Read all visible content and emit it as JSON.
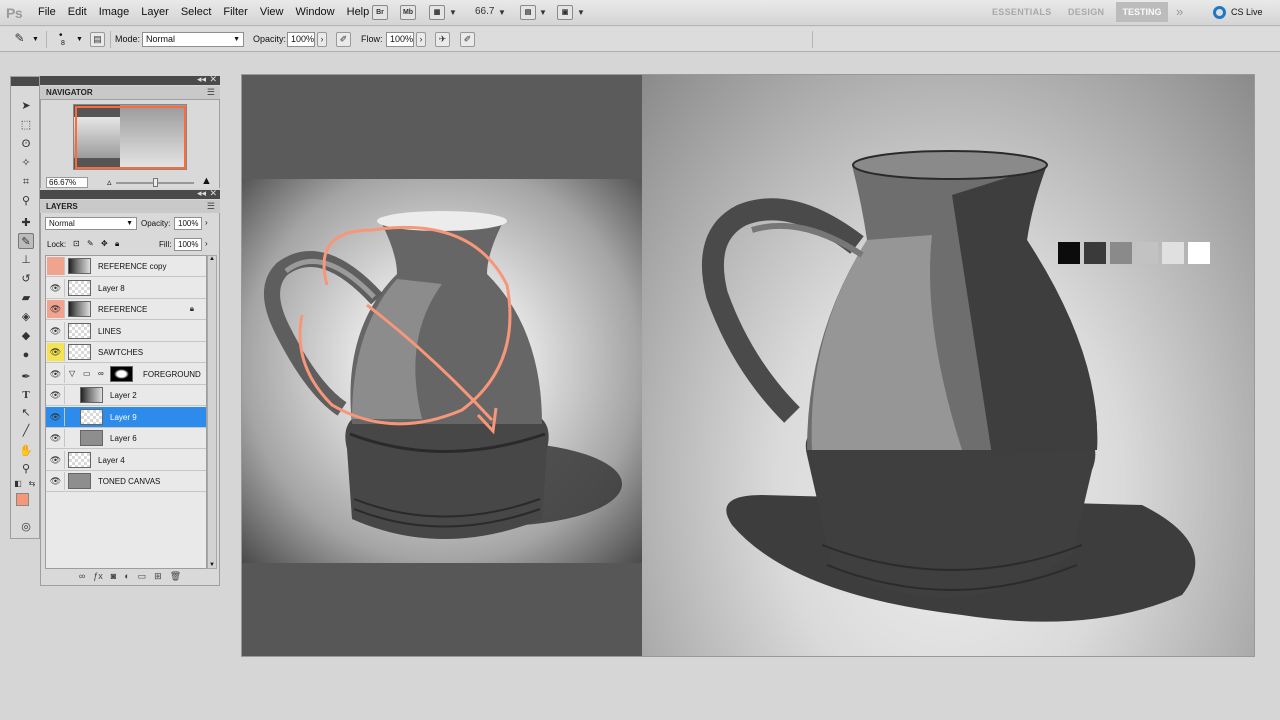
{
  "app": {
    "logo": "Ps",
    "menu": [
      "File",
      "Edit",
      "Image",
      "Layer",
      "Select",
      "Filter",
      "View",
      "Window",
      "Help"
    ],
    "bridge_label": "Br",
    "minibridge_label": "Mb",
    "zoom_value": "66.7",
    "workspaces": [
      "ESSENTIALS",
      "DESIGN",
      "TESTING"
    ],
    "active_workspace": "TESTING",
    "more_glyph": "»",
    "cs_live": "CS Live"
  },
  "options": {
    "brush_size": "8",
    "mode_label": "Mode:",
    "mode_value": "Normal",
    "opacity_label": "Opacity:",
    "opacity_value": "100%",
    "flow_label": "Flow:",
    "flow_value": "100%"
  },
  "navigator": {
    "title": "NAVIGATOR",
    "zoom": "66.67%",
    "slider_level_percent": 50
  },
  "layers_panel": {
    "title": "LAYERS",
    "blend_mode": "Normal",
    "opacity_label": "Opacity:",
    "opacity_value": "100%",
    "lock_label": "Lock:",
    "fill_label": "Fill:",
    "fill_value": "100%",
    "layers": [
      {
        "name": "REFERENCE copy",
        "visible": false,
        "highlight": "red",
        "thumb": "photo",
        "indent": 0,
        "locked": false,
        "selected": false
      },
      {
        "name": "Layer 8",
        "visible": true,
        "highlight": "none",
        "thumb": "transparent",
        "indent": 0,
        "locked": false,
        "selected": false
      },
      {
        "name": "REFERENCE",
        "visible": true,
        "highlight": "red",
        "thumb": "photo",
        "indent": 0,
        "locked": true,
        "selected": false
      },
      {
        "name": "LINES",
        "visible": true,
        "highlight": "none",
        "thumb": "transparent",
        "indent": 0,
        "locked": false,
        "selected": false
      },
      {
        "name": "SAWTCHES",
        "visible": true,
        "highlight": "yellow",
        "thumb": "transparent",
        "indent": 0,
        "locked": false,
        "selected": false
      },
      {
        "name": "FOREGROUND",
        "visible": true,
        "highlight": "none",
        "thumb": "mask",
        "indent": 0,
        "locked": false,
        "selected": false,
        "group": true
      },
      {
        "name": "Layer 2",
        "visible": true,
        "highlight": "none",
        "thumb": "photo",
        "indent": 1,
        "locked": false,
        "selected": false
      },
      {
        "name": "Layer 9",
        "visible": true,
        "highlight": "none",
        "thumb": "transparent",
        "indent": 1,
        "locked": false,
        "selected": true
      },
      {
        "name": "Layer 6",
        "visible": true,
        "highlight": "none",
        "thumb": "grey",
        "indent": 1,
        "locked": false,
        "selected": false
      },
      {
        "name": "Layer 4",
        "visible": true,
        "highlight": "none",
        "thumb": "transparent",
        "indent": 0,
        "locked": false,
        "selected": false
      },
      {
        "name": "TONED CANVAS",
        "visible": true,
        "highlight": "none",
        "thumb": "grey",
        "indent": 0,
        "locked": false,
        "selected": false
      }
    ]
  },
  "colors": {
    "foreground": "#f7977a",
    "background": "#e1e1e1",
    "accent_selection": "#2d8ceb",
    "annotation": "#f7977a"
  },
  "swatches": [
    "#0c0c0c",
    "#3a3a3a",
    "#8a8a8a",
    "#c2c2c2",
    "#e0e0e0",
    "#ffffff"
  ]
}
